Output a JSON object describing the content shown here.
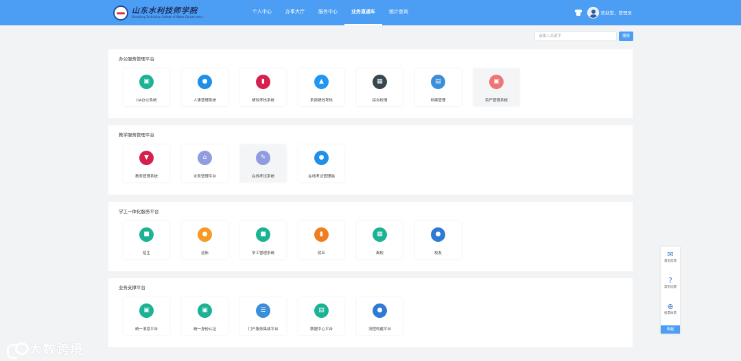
{
  "header": {
    "logo_cn": "山东水利技师学院",
    "logo_en": "Shandong Technician College of Water Conservancy",
    "nav": [
      "个人中心",
      "办事大厅",
      "服务中心",
      "业务直通车",
      "统计查询"
    ],
    "active_nav": "业务直通车",
    "welcome": "欢迎您，管理员"
  },
  "search": {
    "placeholder": "请输入关键字",
    "button": "搜索"
  },
  "sections": [
    {
      "title": "办公服务管理平台",
      "cards": [
        {
          "label": "OA办公系统",
          "icon": "presentation-icon",
          "color": "#1bb394"
        },
        {
          "label": "人事管理系统",
          "icon": "user-icon",
          "color": "#1f8fe8"
        },
        {
          "label": "绩效考核系统",
          "icon": "bar-chart-icon",
          "color": "#d6204e"
        },
        {
          "label": "系部绩效考核",
          "icon": "growth-chart-icon",
          "color": "#2196f3"
        },
        {
          "label": "综合校情",
          "icon": "buildings-icon",
          "color": "#37474f"
        },
        {
          "label": "档案管理",
          "icon": "archive-icon",
          "color": "#3a8fd8"
        },
        {
          "label": "资产管理系统",
          "icon": "asset-icon",
          "color": "#f07474"
        }
      ]
    },
    {
      "title": "教学服务管理平台",
      "cards": [
        {
          "label": "教务管理系统",
          "icon": "screen-download-icon",
          "color": "#d6204e"
        },
        {
          "label": "业务管理平台",
          "icon": "house-icon",
          "color": "#8f9ce0"
        },
        {
          "label": "在线考试系统",
          "icon": "edit-icon",
          "color": "#8f9ce0"
        },
        {
          "label": "在线考试管理端",
          "icon": "user-icon",
          "color": "#1f8fe8"
        }
      ]
    },
    {
      "title": "学工一体化服务平台",
      "cards": [
        {
          "label": "招生",
          "icon": "id-card-icon",
          "color": "#1bb394"
        },
        {
          "label": "迎新",
          "icon": "people-icon",
          "color": "#f59a23"
        },
        {
          "label": "学工管理系统",
          "icon": "id-badge-icon",
          "color": "#1bb394"
        },
        {
          "label": "就业",
          "icon": "bar-chart-icon",
          "color": "#f07e1f"
        },
        {
          "label": "离校",
          "icon": "calendar-icon",
          "color": "#1bb394"
        },
        {
          "label": "校友",
          "icon": "group-icon",
          "color": "#2e7bd6"
        }
      ]
    },
    {
      "title": "业务支撑平台",
      "cards": [
        {
          "label": "统一消息平台",
          "icon": "monitor-icon",
          "color": "#1bb394"
        },
        {
          "label": "统一身份认证",
          "icon": "presentation-icon",
          "color": "#1bb394"
        },
        {
          "label": "门户服务集成平台",
          "icon": "layers-icon",
          "color": "#3a8fd8"
        },
        {
          "label": "数据中心平台",
          "icon": "briefcase-icon",
          "color": "#1bb394"
        },
        {
          "label": "流程构建平台",
          "icon": "group-icon",
          "color": "#2e7bd6"
        }
      ]
    }
  ],
  "float_panel": {
    "items": [
      {
        "label": "意见反馈",
        "icon": "mail-icon"
      },
      {
        "label": "常见问题",
        "icon": "question-icon"
      },
      {
        "label": "投票纠错",
        "icon": "plus-circle-icon"
      }
    ],
    "collapse": "收起"
  },
  "watermark": "大数跨境"
}
